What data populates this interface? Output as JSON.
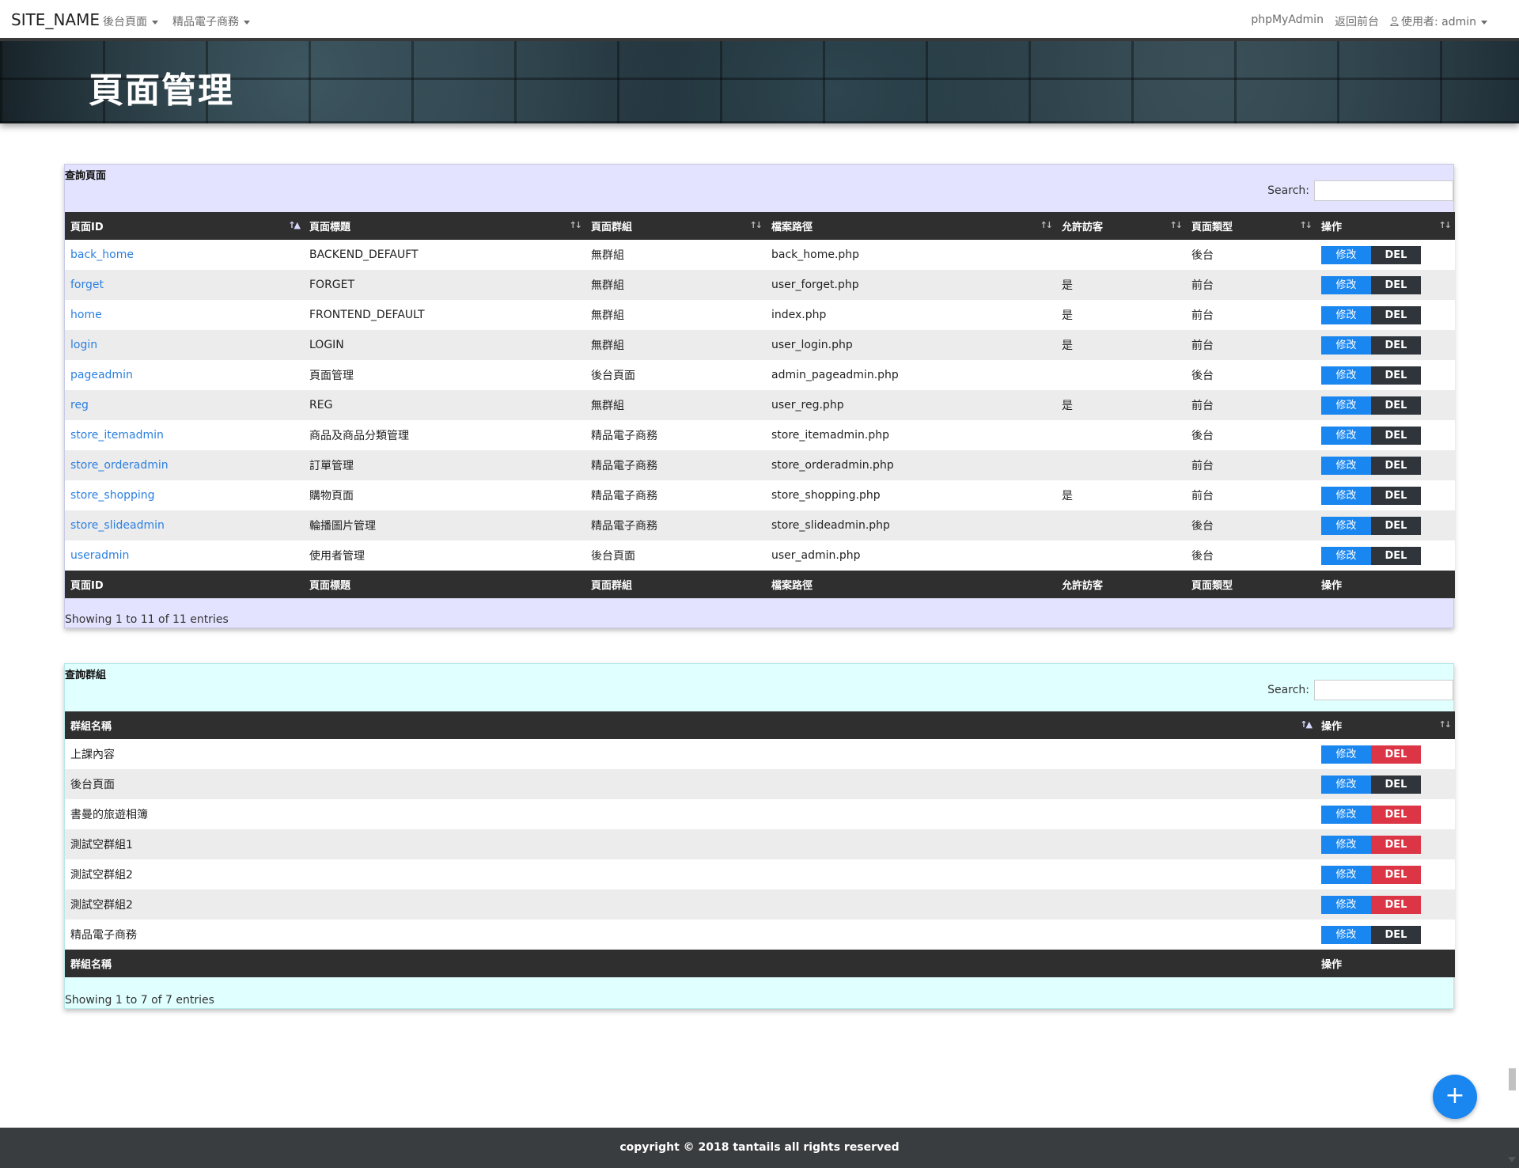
{
  "nav": {
    "brand": "SITE_NAME",
    "left_items": [
      "後台頁面",
      "精品電子商務"
    ],
    "phpmyadmin": "phpMyAdmin",
    "back_frontend": "返回前台",
    "user": "使用者: admin"
  },
  "banner": {
    "title": "頁面管理"
  },
  "pages_card": {
    "title": "查詢頁面",
    "search_label": "Search:",
    "columns": [
      "頁面ID",
      "頁面標題",
      "頁面群組",
      "檔案路徑",
      "允許訪客",
      "頁面類型",
      "操作"
    ],
    "rows": [
      {
        "id": "back_home",
        "title": "BACKEND_DEFAUFT",
        "group": "無群組",
        "path": "back_home.php",
        "guest": "",
        "type": "後台"
      },
      {
        "id": "forget",
        "title": "FORGET",
        "group": "無群組",
        "path": "user_forget.php",
        "guest": "是",
        "type": "前台"
      },
      {
        "id": "home",
        "title": "FRONTEND_DEFAULT",
        "group": "無群組",
        "path": "index.php",
        "guest": "是",
        "type": "前台"
      },
      {
        "id": "login",
        "title": "LOGIN",
        "group": "無群組",
        "path": "user_login.php",
        "guest": "是",
        "type": "前台"
      },
      {
        "id": "pageadmin",
        "title": "頁面管理",
        "group": "後台頁面",
        "path": "admin_pageadmin.php",
        "guest": "",
        "type": "後台"
      },
      {
        "id": "reg",
        "title": "REG",
        "group": "無群組",
        "path": "user_reg.php",
        "guest": "是",
        "type": "前台"
      },
      {
        "id": "store_itemadmin",
        "title": "商品及商品分類管理",
        "group": "精品電子商務",
        "path": "store_itemadmin.php",
        "guest": "",
        "type": "後台"
      },
      {
        "id": "store_orderadmin",
        "title": "訂單管理",
        "group": "精品電子商務",
        "path": "store_orderadmin.php",
        "guest": "",
        "type": "前台"
      },
      {
        "id": "store_shopping",
        "title": "購物頁面",
        "group": "精品電子商務",
        "path": "store_shopping.php",
        "guest": "是",
        "type": "前台"
      },
      {
        "id": "store_slideadmin",
        "title": "輪播圖片管理",
        "group": "精品電子商務",
        "path": "store_slideadmin.php",
        "guest": "",
        "type": "後台"
      },
      {
        "id": "useradmin",
        "title": "使用者管理",
        "group": "後台頁面",
        "path": "user_admin.php",
        "guest": "",
        "type": "後台"
      }
    ],
    "edit_label": "修改",
    "del_label": "DEL",
    "info": "Showing 1 to 11 of 11 entries"
  },
  "groups_card": {
    "title": "查詢群組",
    "search_label": "Search:",
    "columns": [
      "群組名稱",
      "操作"
    ],
    "rows": [
      {
        "name": "上課內容",
        "del_style": "danger"
      },
      {
        "name": "後台頁面",
        "del_style": "dark"
      },
      {
        "name": "書曼的旅遊相簿",
        "del_style": "danger"
      },
      {
        "name": "測試空群組1",
        "del_style": "danger"
      },
      {
        "name": "測試空群組2",
        "del_style": "danger"
      },
      {
        "name": "測試空群組2",
        "del_style": "danger"
      },
      {
        "name": "精品電子商務",
        "del_style": "dark"
      }
    ],
    "edit_label": "修改",
    "del_label": "DEL",
    "info": "Showing 1 to 7 of 7 entries"
  },
  "fab": {
    "label": "+"
  },
  "footer": {
    "text": "copyright © 2018 tantails all rights reserved"
  },
  "colors": {
    "primary": "#1a86f0",
    "danger": "#dc3545",
    "dark": "#2f353b",
    "header": "#2f2f2f"
  }
}
